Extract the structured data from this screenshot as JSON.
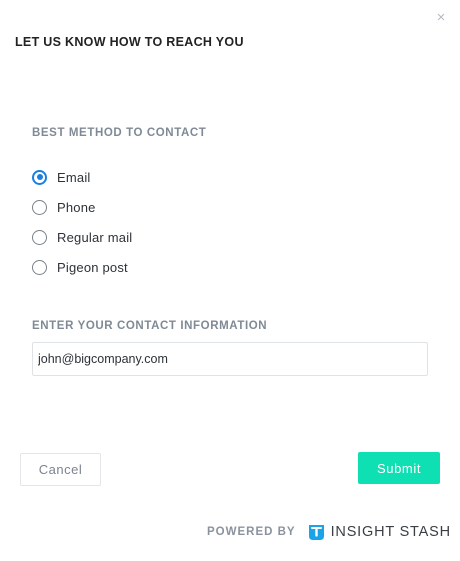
{
  "modal": {
    "close_glyph": "×",
    "title": "LET US KNOW HOW TO REACH YOU"
  },
  "contact_method": {
    "label": "BEST METHOD TO CONTACT",
    "options": [
      {
        "label": "Email",
        "checked": true
      },
      {
        "label": "Phone",
        "checked": false
      },
      {
        "label": "Regular mail",
        "checked": false
      },
      {
        "label": "Pigeon post",
        "checked": false
      }
    ]
  },
  "contact_info": {
    "label": "ENTER YOUR CONTACT INFORMATION",
    "value": "john@bigcompany.com"
  },
  "actions": {
    "cancel_label": "Cancel",
    "submit_label": "Submit"
  },
  "footer": {
    "powered_label": "POWERED BY",
    "brand_name": "INSIGHT STASH",
    "logo_icon": "insight-stash-logo-icon"
  },
  "colors": {
    "accent": "#1a7fe0",
    "submit": "#0fe0b3",
    "logo": "#1aa3e8"
  }
}
